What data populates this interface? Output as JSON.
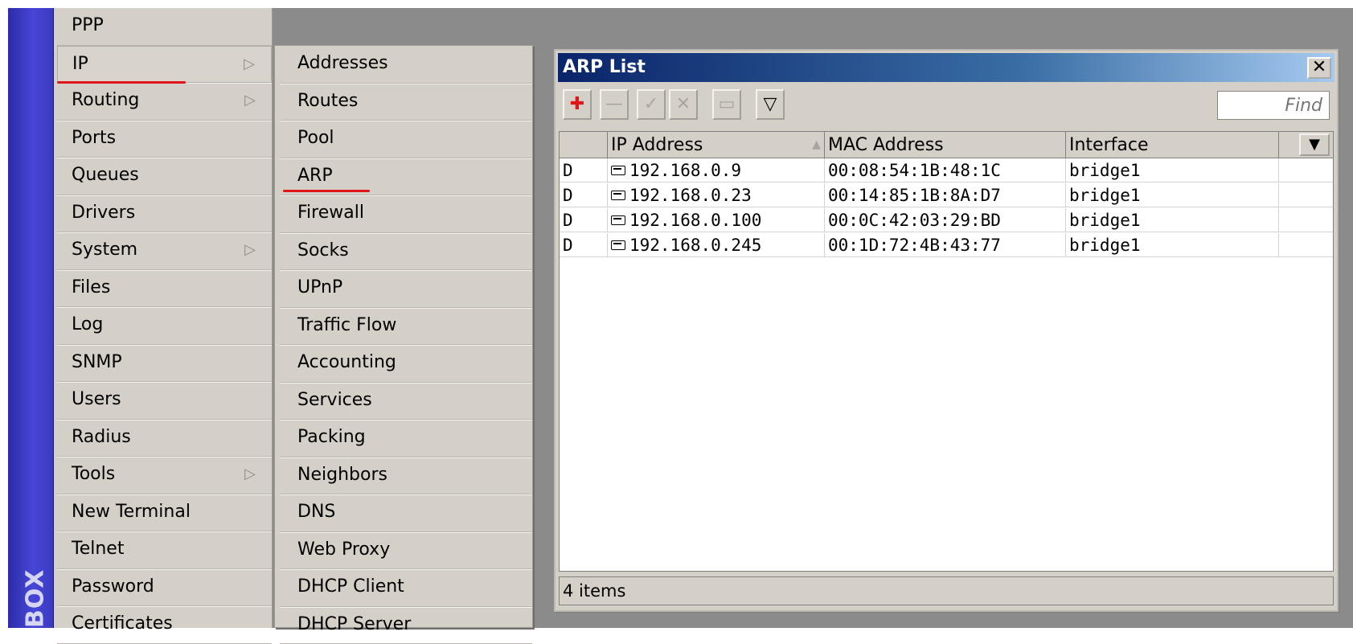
{
  "brand": {
    "text": "BOX"
  },
  "main_menu": {
    "items": [
      {
        "label": "PPP",
        "has_submenu": false
      },
      {
        "label": "IP",
        "has_submenu": true,
        "active": true
      },
      {
        "label": "Routing",
        "has_submenu": true
      },
      {
        "label": "Ports",
        "has_submenu": false
      },
      {
        "label": "Queues",
        "has_submenu": false
      },
      {
        "label": "Drivers",
        "has_submenu": false
      },
      {
        "label": "System",
        "has_submenu": true
      },
      {
        "label": "Files",
        "has_submenu": false
      },
      {
        "label": "Log",
        "has_submenu": false
      },
      {
        "label": "SNMP",
        "has_submenu": false
      },
      {
        "label": "Users",
        "has_submenu": false
      },
      {
        "label": "Radius",
        "has_submenu": false
      },
      {
        "label": "Tools",
        "has_submenu": true
      },
      {
        "label": "New Terminal",
        "has_submenu": false
      },
      {
        "label": "Telnet",
        "has_submenu": false
      },
      {
        "label": "Password",
        "has_submenu": false
      },
      {
        "label": "Certificates",
        "has_submenu": false
      }
    ],
    "arrow": "▷"
  },
  "ip_submenu": {
    "items": [
      {
        "label": "Addresses"
      },
      {
        "label": "Routes"
      },
      {
        "label": "Pool"
      },
      {
        "label": "ARP",
        "highlighted": true
      },
      {
        "label": "Firewall"
      },
      {
        "label": "Socks"
      },
      {
        "label": "UPnP"
      },
      {
        "label": "Traffic Flow"
      },
      {
        "label": "Accounting"
      },
      {
        "label": "Services"
      },
      {
        "label": "Packing"
      },
      {
        "label": "Neighbors"
      },
      {
        "label": "DNS"
      },
      {
        "label": "Web Proxy"
      },
      {
        "label": "DHCP Client"
      },
      {
        "label": "DHCP Server"
      }
    ]
  },
  "arp_window": {
    "title": "ARP List",
    "close_label": "✕",
    "toolbar": {
      "add_label": "✚",
      "remove_label": "—",
      "enable_label": "✓",
      "disable_label": "✕",
      "comment_label": "▭",
      "filter_label": "▽"
    },
    "find_placeholder": "Find",
    "columns": [
      "",
      "IP Address",
      "MAC Address",
      "Interface"
    ],
    "sort_indicator": "▲",
    "rows": [
      {
        "flag": "D",
        "ip": "192.168.0.9",
        "mac": "00:08:54:1B:48:1C",
        "interface": "bridge1"
      },
      {
        "flag": "D",
        "ip": "192.168.0.23",
        "mac": "00:14:85:1B:8A:D7",
        "interface": "bridge1"
      },
      {
        "flag": "D",
        "ip": "192.168.0.100",
        "mac": "00:0C:42:03:29:BD",
        "interface": "bridge1"
      },
      {
        "flag": "D",
        "ip": "192.168.0.245",
        "mac": "00:1D:72:4B:43:77",
        "interface": "bridge1"
      }
    ],
    "status": "4 items"
  },
  "colors": {
    "accent_red": "#e0161b",
    "titlebar": "#0a246a",
    "menu_bg": "#d4d0c8"
  }
}
